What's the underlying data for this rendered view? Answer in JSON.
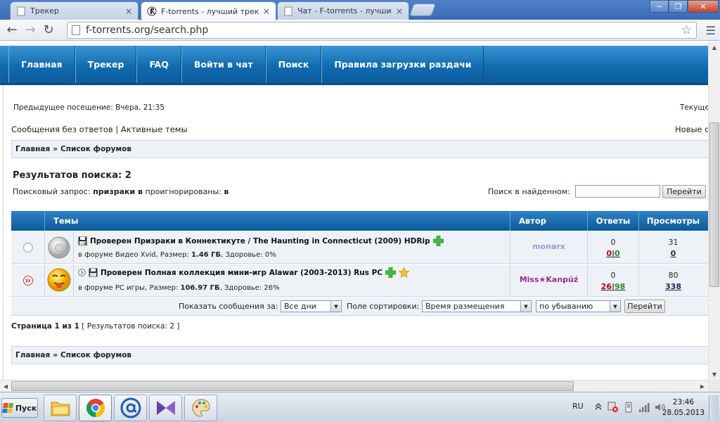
{
  "browser": {
    "tabs": [
      {
        "title": "Трекер",
        "active": false
      },
      {
        "title": "F-torrents - лучший трекер",
        "active": true
      },
      {
        "title": "Чат - F-torrents - лучший тр",
        "active": false
      }
    ],
    "close_glyph": "×",
    "url": "f-torrents.org/search.php",
    "win_min": "─",
    "win_max": "❐",
    "win_close": "✕"
  },
  "nav": {
    "items": [
      "Главная",
      "Трекер",
      "FAQ",
      "Войти в чат",
      "Поиск",
      "Правила загрузки раздачи"
    ]
  },
  "page": {
    "last_visit": "Предыдущее посещение: Вчера, 21:35",
    "current_time_cut": "Текуще",
    "links": {
      "unanswered": "Сообщения без ответов",
      "separator": "|",
      "active": "Активные темы",
      "new_cut": "Новые с"
    },
    "breadcrumb": {
      "home": "Главная",
      "sep": "»",
      "forums": "Список форумов"
    },
    "results_title": "Результатов поиска: 2",
    "query_label": "Поисковый запрос:",
    "query_value": "призраки в",
    "ignored_label": "проигнорированы:",
    "ignored_value": "в",
    "search_in_found_label": "Поиск в найденном:",
    "search_in_found_value": "",
    "go_button": "Перейти",
    "table": {
      "headers": {
        "topics": "Темы",
        "author": "Автор",
        "replies": "Ответы",
        "views": "Просмотры"
      },
      "rows": [
        {
          "status": "Проверен",
          "title": "Призраки в Коннектикуте / The Haunting in Connecticut (2009) HDRip",
          "forum_prefix": "в форуме",
          "forum": "Видео Xvid",
          "size_label": "Размер:",
          "size": "1.46 ГБ",
          "health_label": "Здоровье:",
          "health": "0%",
          "author": "monarx",
          "author_color": "#8f9fd9",
          "replies": "0",
          "seeders": "0",
          "leechers": "0",
          "views": "31",
          "views_bottom": "0",
          "icon": "cd-disc-icon"
        },
        {
          "status": "Проверен",
          "title": "Полная коллекция мини-игр Alawar (2003-2013) Rus PC",
          "forum_prefix": "в форуме",
          "forum": "PC игры",
          "size_label": "Размер:",
          "size": "106.97 ГБ",
          "health_label": "Здоровье:",
          "health": "26%",
          "author": "Miss★Kanpúź",
          "author_color": "#a0288f",
          "replies": "0",
          "seeders": "26",
          "leechers": "98",
          "views": "80",
          "views_bottom": "338",
          "icon": "smiley-tongue-icon"
        }
      ],
      "seed_leech_sep": "|"
    },
    "filters": {
      "show_label": "Показать сообщения за:",
      "show_value": "Все дни",
      "sort_label": "Поле сортировки:",
      "sort_value": "Время размещения",
      "order_value": "по убыванию",
      "go": "Перейти"
    },
    "pagination": {
      "text": "Страница 1 из 1",
      "count": "[ Результатов поиска: 2 ]"
    }
  },
  "taskbar": {
    "start": "Пуск",
    "lang": "RU",
    "time": "23:46",
    "date": "28.05.2013"
  }
}
